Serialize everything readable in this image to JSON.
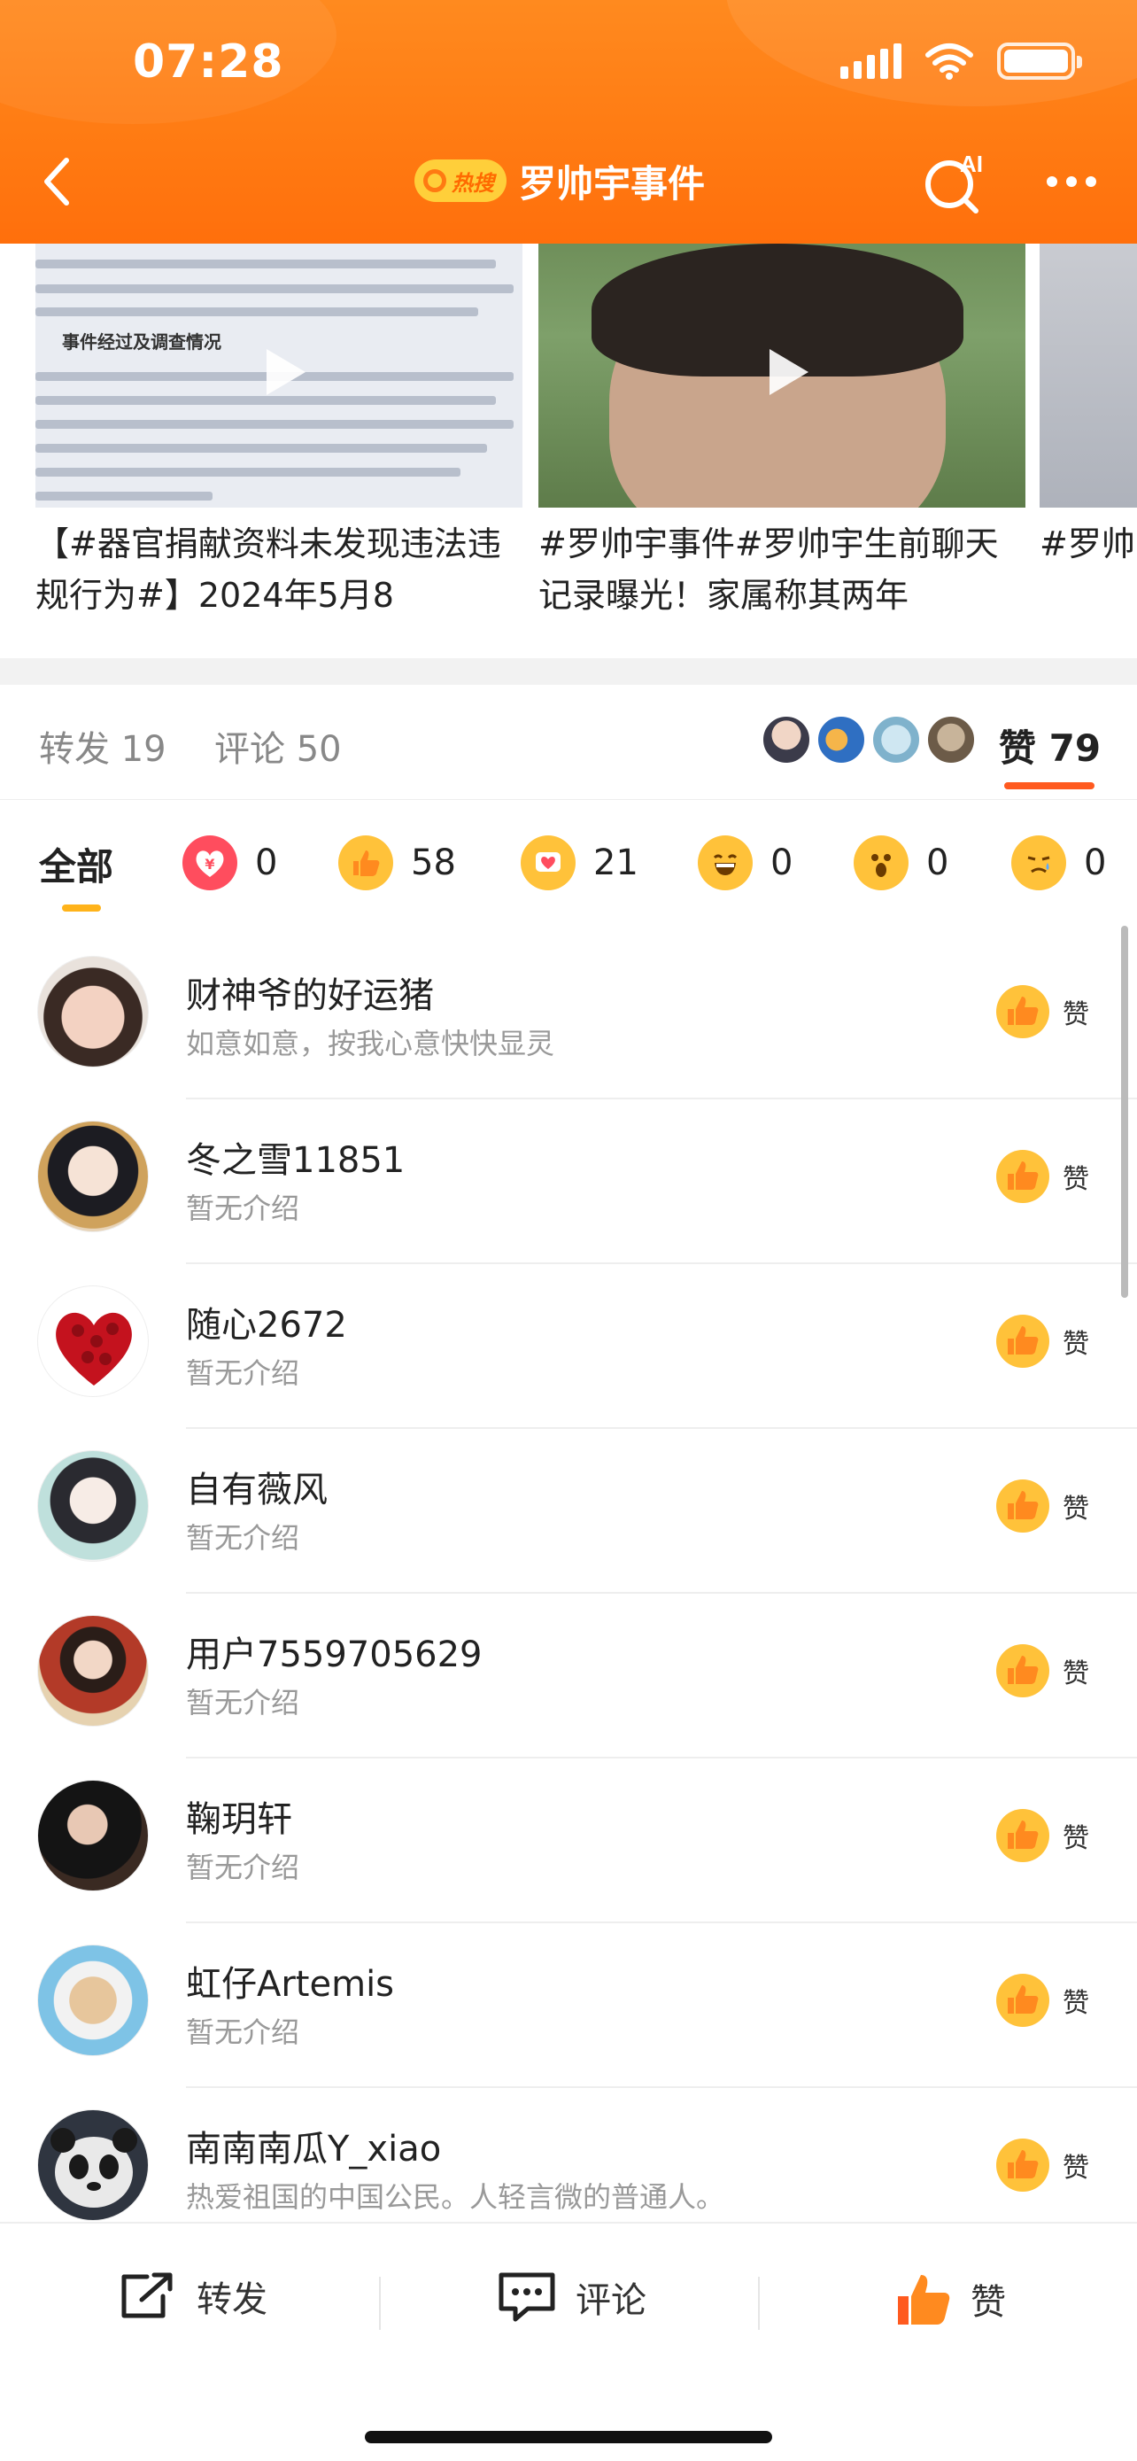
{
  "status_bar": {
    "time": "07:28"
  },
  "nav": {
    "hot_badge": "热搜",
    "title": "罗帅宇事件",
    "ai_label": "AI"
  },
  "videos": [
    {
      "title": "【#器官捐献资料未发现违法违规行为#】2024年5月8",
      "doc_heading": "事件经过及调查情况"
    },
    {
      "title": "#罗帅宇事件#罗帅宇生前聊天记录曝光！家属称其两年"
    },
    {
      "title": "#罗帅宇饭闲聊"
    }
  ],
  "interaction_tabs": {
    "repost": "转发 19",
    "comment": "评论 50",
    "like": "赞 79"
  },
  "reaction_filters": {
    "all": "全部",
    "items": [
      {
        "icon": "money-icon",
        "count": "0"
      },
      {
        "icon": "thumbs-up-icon",
        "count": "58"
      },
      {
        "icon": "heart-icon",
        "count": "21"
      },
      {
        "icon": "laugh-icon",
        "count": "0"
      },
      {
        "icon": "surprised-icon",
        "count": "0"
      },
      {
        "icon": "sad-icon",
        "count": "0"
      }
    ]
  },
  "likers": [
    {
      "name": "财神爷的好运猪",
      "bio": "如意如意，按我心意快快显灵",
      "like_label": "赞"
    },
    {
      "name": "冬之雪11851",
      "bio": "暂无介绍",
      "like_label": "赞"
    },
    {
      "name": "随心2672",
      "bio": "暂无介绍",
      "like_label": "赞"
    },
    {
      "name": "自有薇风",
      "bio": "暂无介绍",
      "like_label": "赞"
    },
    {
      "name": "用户7559705629",
      "bio": "暂无介绍",
      "like_label": "赞"
    },
    {
      "name": "鞠玥轩",
      "bio": "暂无介绍",
      "like_label": "赞"
    },
    {
      "name": "虹仔Artemis",
      "bio": "暂无介绍",
      "like_label": "赞"
    },
    {
      "name": "南南南瓜Y_xiao",
      "bio": "热爱祖国的中国公民。人轻言微的普通人。",
      "like_label": "赞"
    }
  ],
  "bottom_bar": {
    "repost": "转发",
    "comment": "评论",
    "like": "赞"
  },
  "colors": {
    "brand_orange": "#ff7a12",
    "like_accent": "#ff5a1f",
    "tab_underline": "#ffb31a"
  }
}
